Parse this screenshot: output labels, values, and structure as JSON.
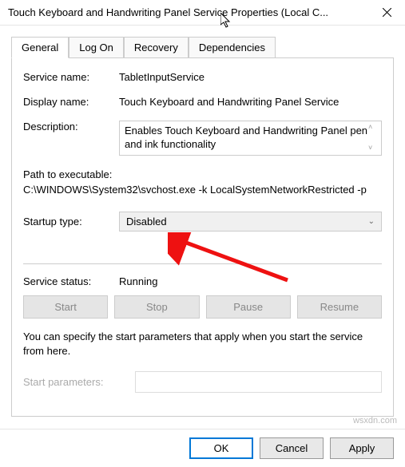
{
  "window": {
    "title": "Touch Keyboard and Handwriting Panel Service Properties (Local C..."
  },
  "tabs": {
    "general": "General",
    "logon": "Log On",
    "recovery": "Recovery",
    "dependencies": "Dependencies"
  },
  "general": {
    "service_name_label": "Service name:",
    "service_name_value": "TabletInputService",
    "display_name_label": "Display name:",
    "display_name_value": "Touch Keyboard and Handwriting Panel Service",
    "description_label": "Description:",
    "description_value": "Enables Touch Keyboard and Handwriting Panel pen and ink functionality",
    "path_label": "Path to executable:",
    "path_value": "C:\\WINDOWS\\System32\\svchost.exe -k LocalSystemNetworkRestricted -p",
    "startup_type_label": "Startup type:",
    "startup_type_value": "Disabled",
    "service_status_label": "Service status:",
    "service_status_value": "Running",
    "buttons": {
      "start": "Start",
      "stop": "Stop",
      "pause": "Pause",
      "resume": "Resume"
    },
    "note": "You can specify the start parameters that apply when you start the service from here.",
    "start_parameters_label": "Start parameters:"
  },
  "dialog_buttons": {
    "ok": "OK",
    "cancel": "Cancel",
    "apply": "Apply"
  },
  "watermark": "wsxdn.com"
}
